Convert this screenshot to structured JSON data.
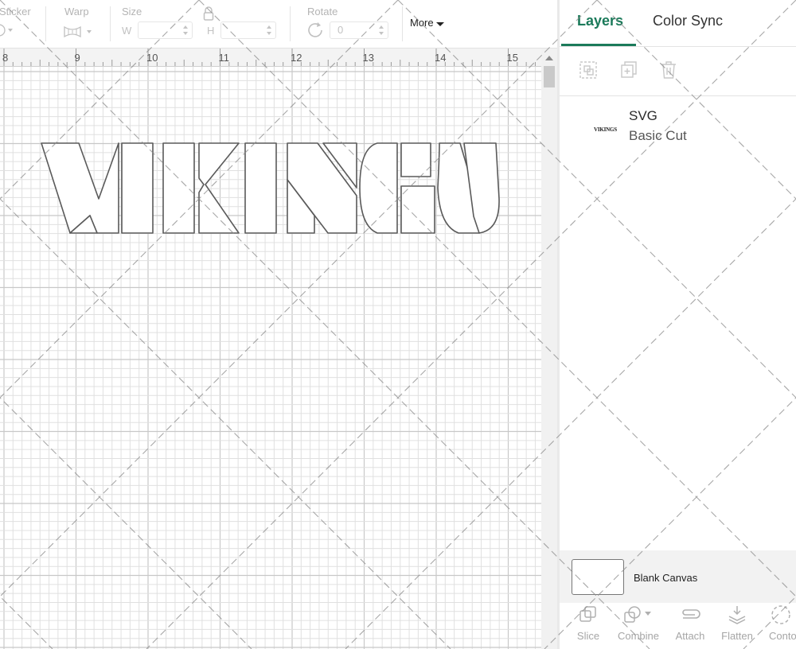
{
  "toolbar": {
    "sticker_label": "Sticker",
    "warp_label": "Warp",
    "size_label": "Size",
    "size_w_label": "W",
    "size_h_label": "H",
    "rotate_label": "Rotate",
    "rotate_value": "0",
    "more_label": "More"
  },
  "ruler": {
    "ticks": [
      "8",
      "9",
      "10",
      "11",
      "12",
      "13",
      "14",
      "15"
    ]
  },
  "canvas": {
    "text": "VIKINGS"
  },
  "panel": {
    "tabs": [
      {
        "label": "Layers",
        "active": true
      },
      {
        "label": "Color Sync",
        "active": false
      }
    ],
    "layer": {
      "title": "SVG",
      "subtitle": "Basic Cut",
      "thumb_text": "VIKINGS"
    },
    "blank_canvas_label": "Blank Canvas",
    "bottom_tools": [
      {
        "label": "Slice",
        "icon": "slice-icon"
      },
      {
        "label": "Combine",
        "icon": "combine-icon"
      },
      {
        "label": "Attach",
        "icon": "attach-icon"
      },
      {
        "label": "Flatten",
        "icon": "flatten-icon"
      },
      {
        "label": "Contour",
        "icon": "contour-icon"
      }
    ]
  },
  "colors": {
    "accent": "#1b7a5a",
    "grid": "#e0e0e0",
    "grid_major": "#c8c8c8"
  }
}
